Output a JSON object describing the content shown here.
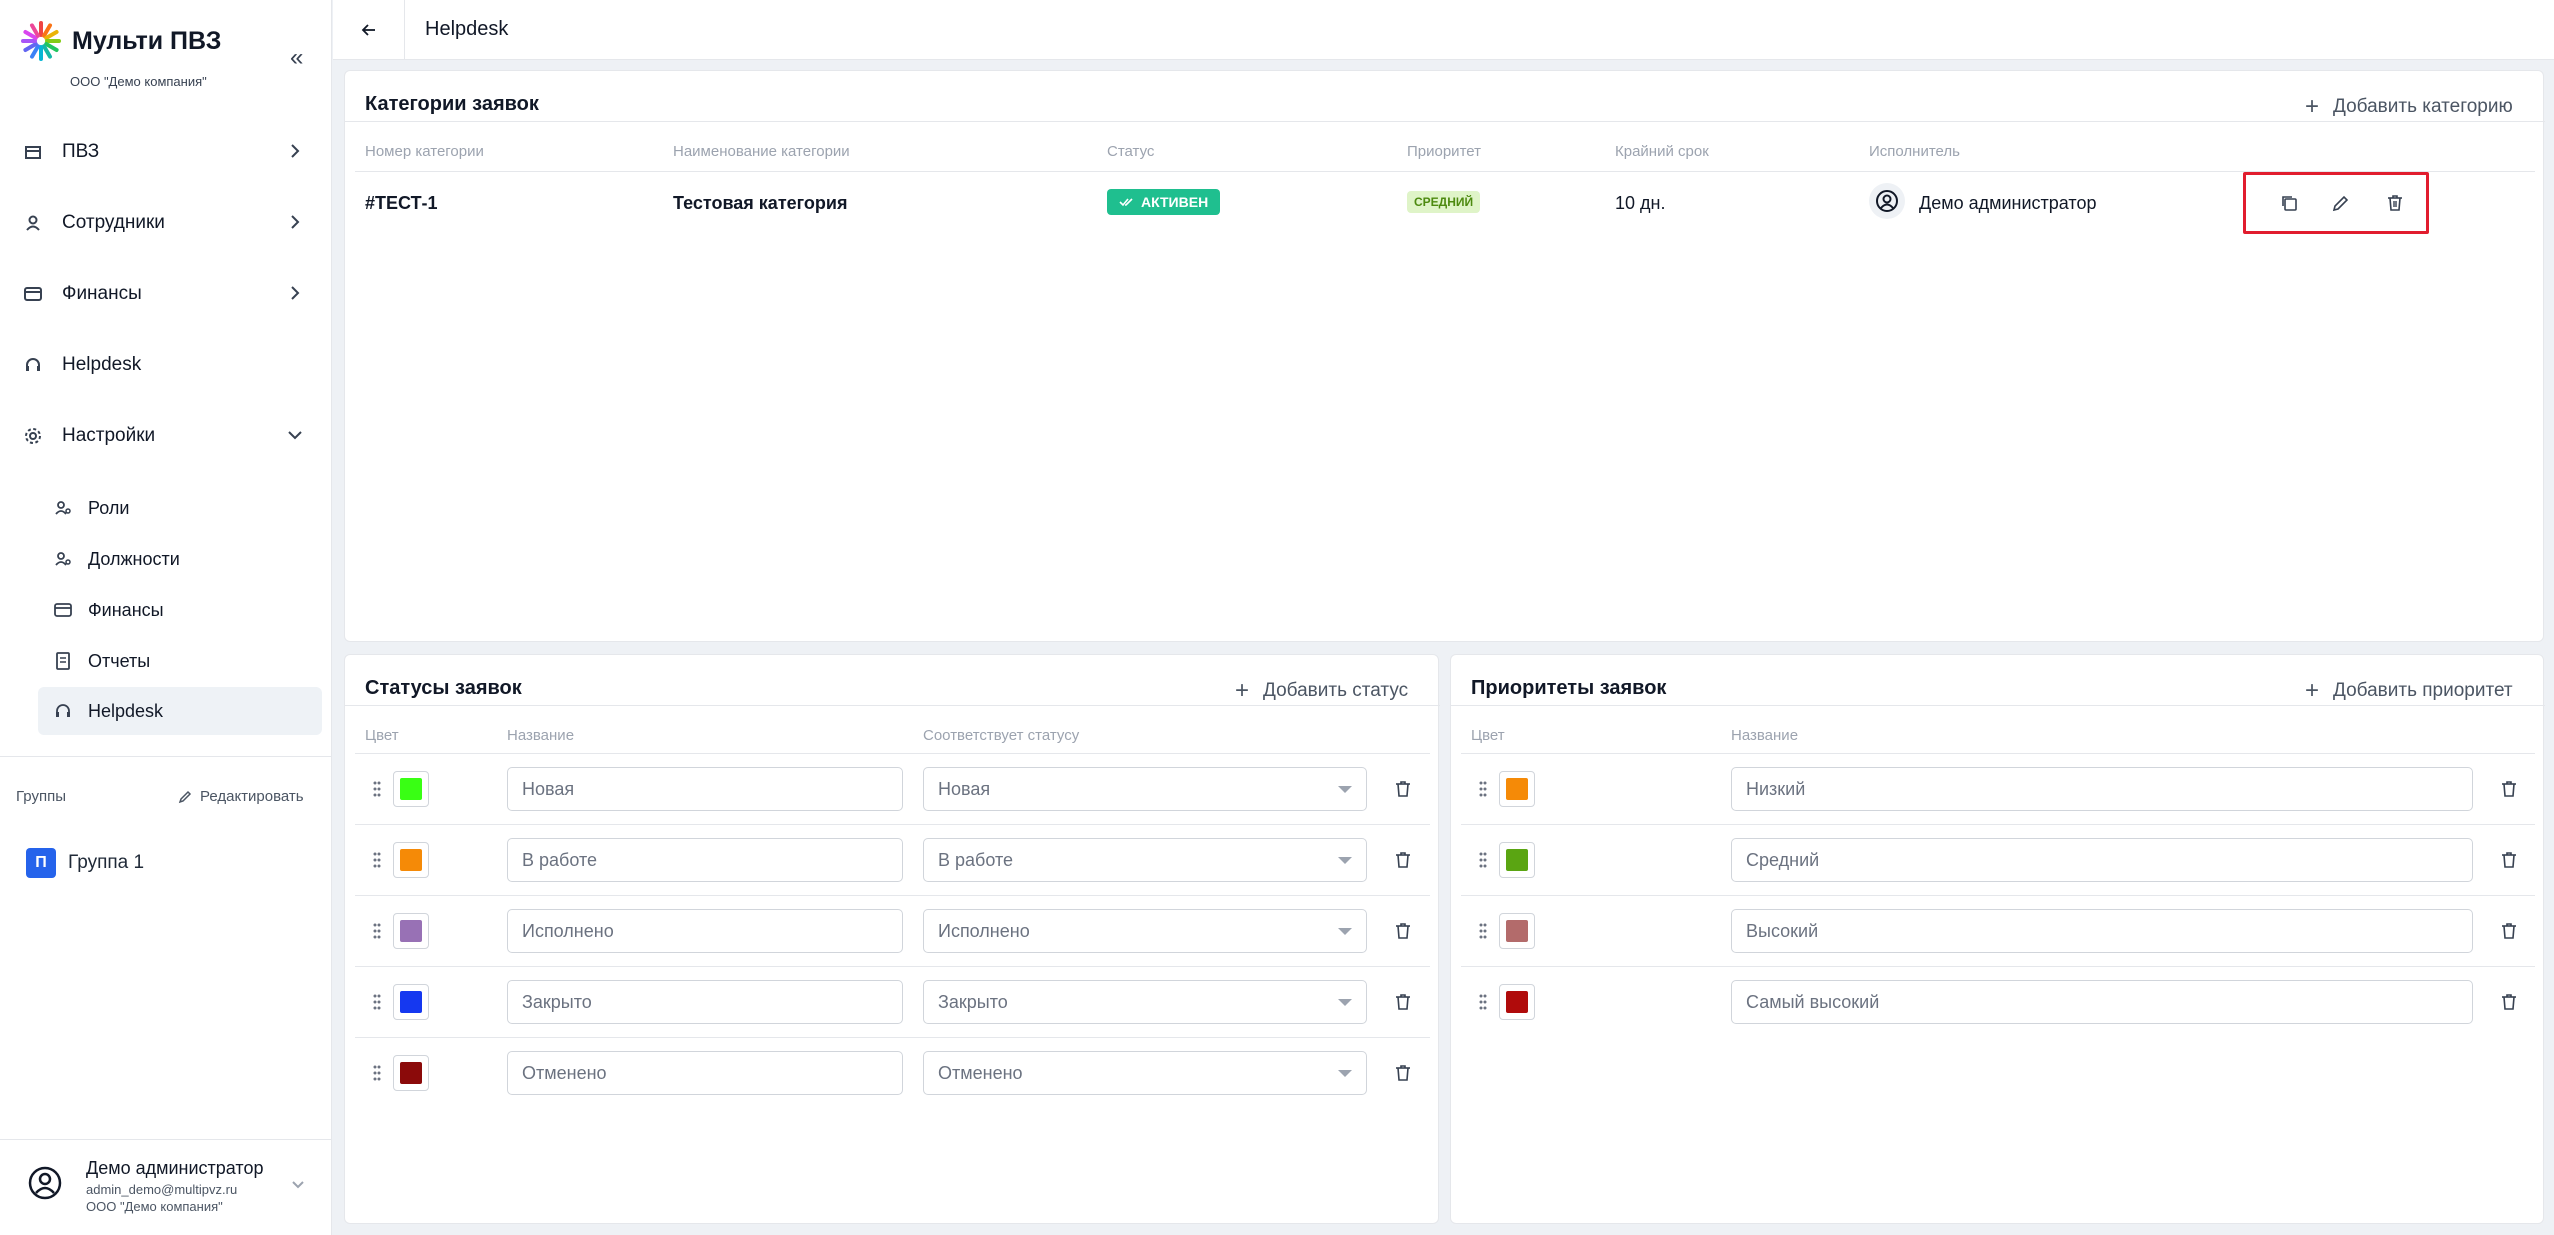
{
  "brand": {
    "title": "Мульти ПВЗ",
    "org": "ООО \"Демо компания\""
  },
  "topbar": {
    "title": "Helpdesk"
  },
  "sidebar": {
    "items": [
      {
        "label": "ПВЗ",
        "icon": "store-icon"
      },
      {
        "label": "Сотрудники",
        "icon": "user-icon"
      },
      {
        "label": "Финансы",
        "icon": "card-icon"
      },
      {
        "label": "Helpdesk",
        "icon": "headset-icon"
      },
      {
        "label": "Настройки",
        "icon": "gear-icon"
      }
    ],
    "settings_items": [
      {
        "label": "Роли"
      },
      {
        "label": "Должности"
      },
      {
        "label": "Финансы"
      },
      {
        "label": "Отчеты"
      },
      {
        "label": "Helpdesk"
      }
    ],
    "groups_title": "Группы",
    "groups_edit": "Редактировать",
    "group": {
      "badge": "П",
      "label": "Группа 1"
    }
  },
  "user": {
    "name": "Демо администратор",
    "email": "admin_demo@multipvz.ru",
    "org": "ООО \"Демо компания\""
  },
  "categories": {
    "title": "Категории заявок",
    "add_label": "Добавить категорию",
    "headers": [
      "Номер категории",
      "Наименование категории",
      "Статус",
      "Приоритет",
      "Крайний срок",
      "Исполнитель"
    ],
    "row": {
      "number": "#ТЕСТ-1",
      "name": "Тестовая категория",
      "status": "АКТИВЕН",
      "priority": "СРЕДНИЙ",
      "deadline": "10 дн.",
      "executor": "Демо администратор"
    }
  },
  "statuses": {
    "title": "Статусы заявок",
    "add_label": "Добавить статус",
    "headers": {
      "color": "Цвет",
      "name": "Название",
      "match": "Соответствует статусу"
    },
    "rows": [
      {
        "color": "#39ff14",
        "name": "Новая",
        "match": "Новая"
      },
      {
        "color": "#f58a07",
        "name": "В работе",
        "match": "В работе"
      },
      {
        "color": "#9871b5",
        "name": "Исполнено",
        "match": "Исполнено"
      },
      {
        "color": "#1538f0",
        "name": "Закрыто",
        "match": "Закрыто"
      },
      {
        "color": "#8b0a0a",
        "name": "Отменено",
        "match": "Отменено"
      }
    ]
  },
  "priorities": {
    "title": "Приоритеты заявок",
    "add_label": "Добавить приоритет",
    "headers": {
      "color": "Цвет",
      "name": "Название"
    },
    "rows": [
      {
        "color": "#f58a07",
        "name": "Низкий"
      },
      {
        "color": "#5aa512",
        "name": "Средний"
      },
      {
        "color": "#b36b6b",
        "name": "Высокий"
      },
      {
        "color": "#b00b0b",
        "name": "Самый высокий"
      }
    ]
  }
}
